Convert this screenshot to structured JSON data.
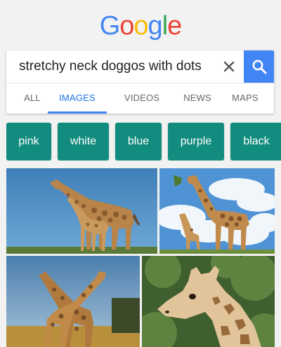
{
  "logo": {
    "letters": [
      "G",
      "o",
      "o",
      "g",
      "l",
      "e"
    ],
    "colors": [
      "#4285f4",
      "#ea4335",
      "#fbbc05",
      "#4285f4",
      "#34a853",
      "#ea4335"
    ]
  },
  "search": {
    "query": "stretchy neck doggos with dots",
    "clear_icon": "close-icon",
    "search_icon": "search-icon",
    "accent_color": "#4285f4"
  },
  "tabs": [
    {
      "label": "ALL",
      "active": false
    },
    {
      "label": "IMAGES",
      "active": true
    },
    {
      "label": "VIDEOS",
      "active": false
    },
    {
      "label": "NEWS",
      "active": false
    },
    {
      "label": "MAPS",
      "active": false
    }
  ],
  "chips": [
    {
      "label": "pink"
    },
    {
      "label": "white"
    },
    {
      "label": "blue"
    },
    {
      "label": "purple"
    },
    {
      "label": "black"
    }
  ],
  "chip_color": "#128c7e",
  "images": [
    {
      "name": "giraffe-adult-and-calf-blue-sky"
    },
    {
      "name": "giraffes-cloudy-sky-eating"
    },
    {
      "name": "giraffes-necks-crossed-sunset"
    },
    {
      "name": "giraffe-head-closeup-trees"
    }
  ]
}
